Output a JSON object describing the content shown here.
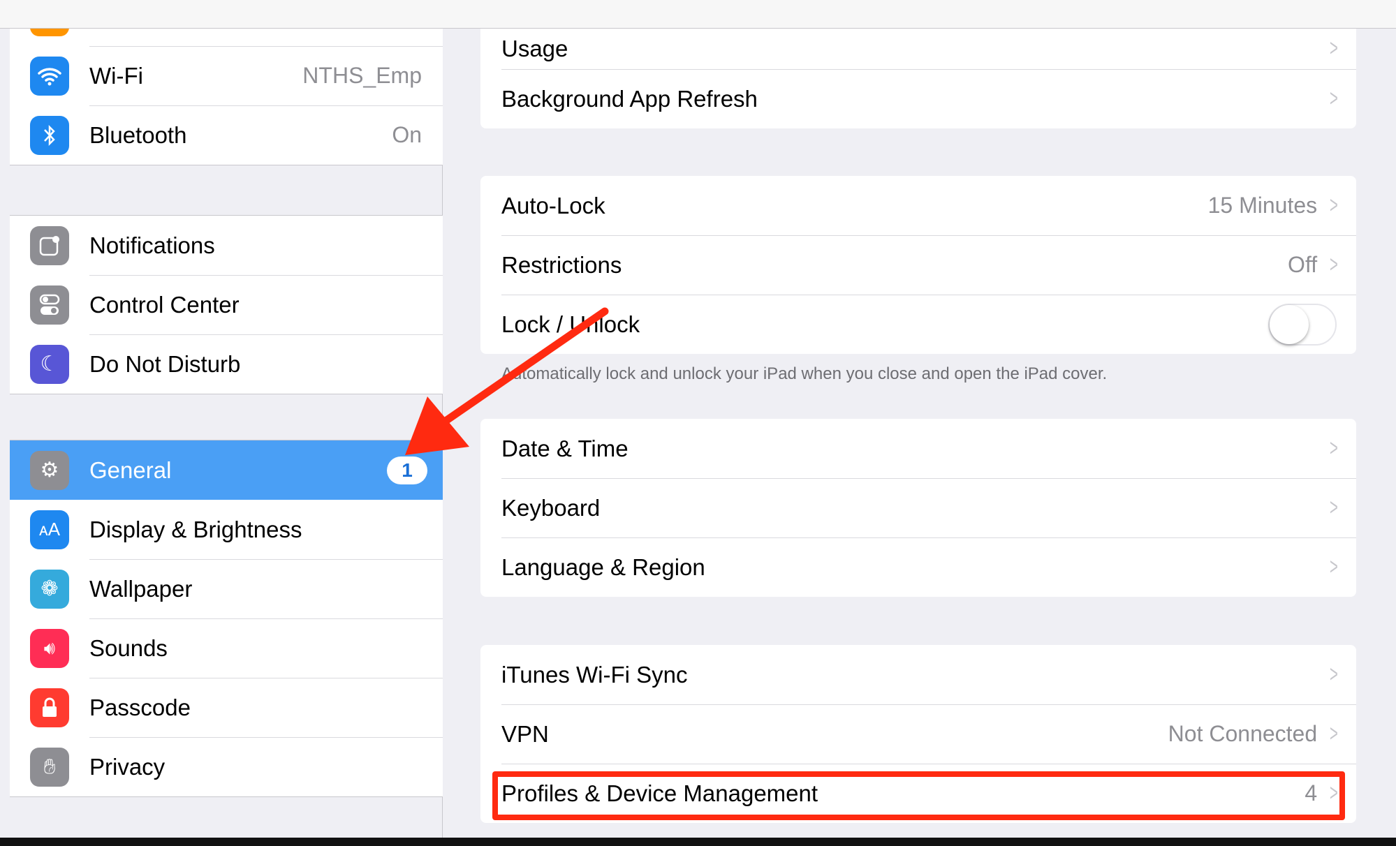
{
  "sidebar": {
    "group1": [
      {
        "label": "",
        "icon": "airplane-icon",
        "color": "#ff9500",
        "toggle": false
      },
      {
        "label": "Wi-Fi",
        "value": "NTHS_Emp",
        "icon": "wifi-icon",
        "color": "#1e88f0"
      },
      {
        "label": "Bluetooth",
        "value": "On",
        "icon": "bluetooth-icon",
        "color": "#1e88f0"
      }
    ],
    "group2": [
      {
        "label": "Notifications",
        "icon": "notifications-icon",
        "color": "#8e8e93"
      },
      {
        "label": "Control Center",
        "icon": "control-center-icon",
        "color": "#8e8e93"
      },
      {
        "label": "Do Not Disturb",
        "icon": "moon-icon",
        "color": "#5856d6"
      }
    ],
    "group3": [
      {
        "label": "General",
        "badge": "1",
        "icon": "gear-icon",
        "color": "#8e8e93",
        "selected": true
      },
      {
        "label": "Display & Brightness",
        "icon": "display-icon",
        "color": "#1e88f0"
      },
      {
        "label": "Wallpaper",
        "icon": "wallpaper-icon",
        "color": "#35aadc"
      },
      {
        "label": "Sounds",
        "icon": "sounds-icon",
        "color": "#ff2d55"
      },
      {
        "label": "Passcode",
        "icon": "lock-icon",
        "color": "#ff3b30"
      },
      {
        "label": "Privacy",
        "icon": "hand-icon",
        "color": "#8e8e93"
      }
    ]
  },
  "main": {
    "card1": [
      {
        "label": "Usage"
      },
      {
        "label": "Background App Refresh"
      }
    ],
    "card2": [
      {
        "label": "Auto-Lock",
        "value": "15 Minutes"
      },
      {
        "label": "Restrictions",
        "value": "Off"
      },
      {
        "label": "Lock / Unlock",
        "toggle": false
      }
    ],
    "card2_footer": "Automatically lock and unlock your iPad when you close and open the iPad cover.",
    "card3": [
      {
        "label": "Date & Time"
      },
      {
        "label": "Keyboard"
      },
      {
        "label": "Language & Region"
      }
    ],
    "card4": [
      {
        "label": "iTunes Wi-Fi Sync"
      },
      {
        "label": "VPN",
        "value": "Not Connected"
      },
      {
        "label": "Profiles & Device Management",
        "value": "4"
      }
    ]
  },
  "annotations": {
    "arrow_color": "#ff2a10",
    "highlight_color": "#ff2a10"
  }
}
